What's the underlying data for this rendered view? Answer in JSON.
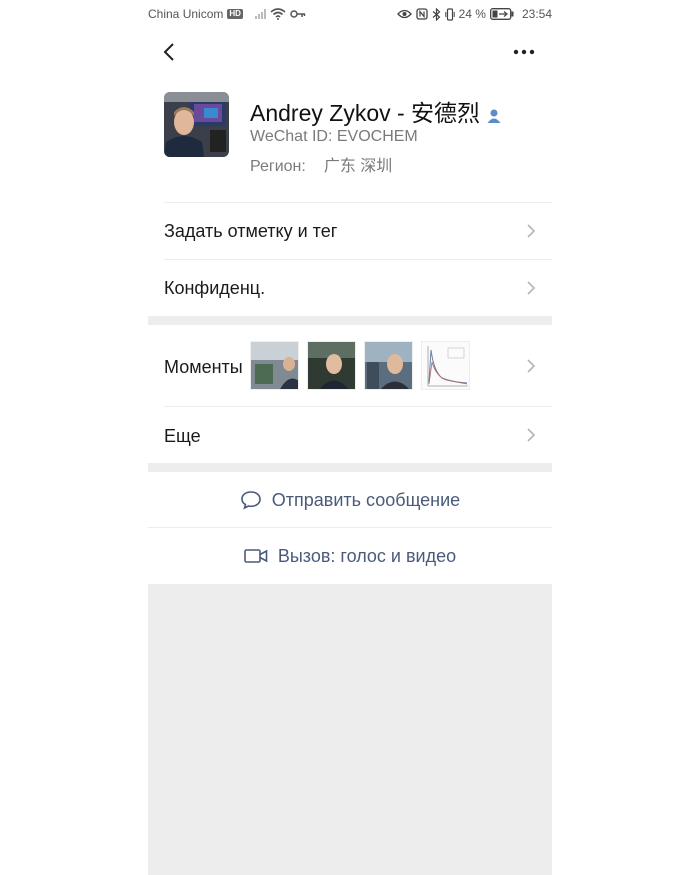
{
  "status_bar": {
    "carrier": "China Unicom",
    "hd_badge": "HD",
    "battery_percent": "24 %",
    "time": "23:54"
  },
  "nav": {
    "back_icon": "chevron-left-icon",
    "more_icon": "ellipsis-icon"
  },
  "profile": {
    "name": "Andrey Zykov - 安德烈",
    "wechat_id": "WeChat ID:  EVOCHEM",
    "region_label": "Регион:",
    "region_value": "广东  深圳"
  },
  "rows": {
    "remark": "Задать отметку и тег",
    "privacy": "Конфиденц.",
    "moments": "Моменты",
    "more": "Еще"
  },
  "actions": {
    "message": "Отправить сообщение",
    "call": "Вызов: голос и видео"
  },
  "colors": {
    "accent_link": "#4a5a7a",
    "verified": "#5b8cc9",
    "band": "#ededed"
  }
}
